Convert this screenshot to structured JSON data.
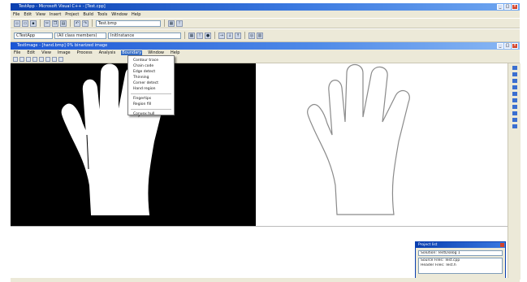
{
  "ide": {
    "title": "TestApp - Microsoft Visual C++ - [Test.cpp]",
    "menus": [
      "File",
      "Edit",
      "View",
      "Insert",
      "Project",
      "Build",
      "Tools",
      "Window",
      "Help"
    ],
    "combo_find": "Test.bmp",
    "combo_class": "CTestApp",
    "combo_members": "(All class members)",
    "combo_function": "InitInstance"
  },
  "child": {
    "title": "TestImage - [hand.bmp] 0% binarized image",
    "menus": [
      "File",
      "Edit",
      "View",
      "Image",
      "Process",
      "Analysis",
      "Boundary",
      "Window",
      "Help"
    ],
    "active_menu": "Boundary"
  },
  "dropdown": {
    "items": [
      "Contour trace",
      "Chain code",
      "Edge detect",
      "Thinning",
      "Corner detect",
      "Hand region",
      "Fingertips",
      "Region fill",
      "Convex hull",
      "Show result"
    ]
  },
  "dialog": {
    "title": "Project list",
    "field": "Solution: TestDialog 1",
    "rows": [
      "Source Files: Test.cpp",
      "Header Files: Test.h"
    ]
  },
  "colors": {
    "title_blue": "#0a3fb0",
    "menu_highlight": "#316ac5",
    "chrome_gray": "#ece9d8"
  },
  "icons": [
    "new-file-icon",
    "open-folder-icon",
    "save-icon",
    "cut-icon",
    "copy-icon",
    "paste-icon",
    "undo-icon",
    "redo-icon",
    "build-icon",
    "run-icon"
  ]
}
